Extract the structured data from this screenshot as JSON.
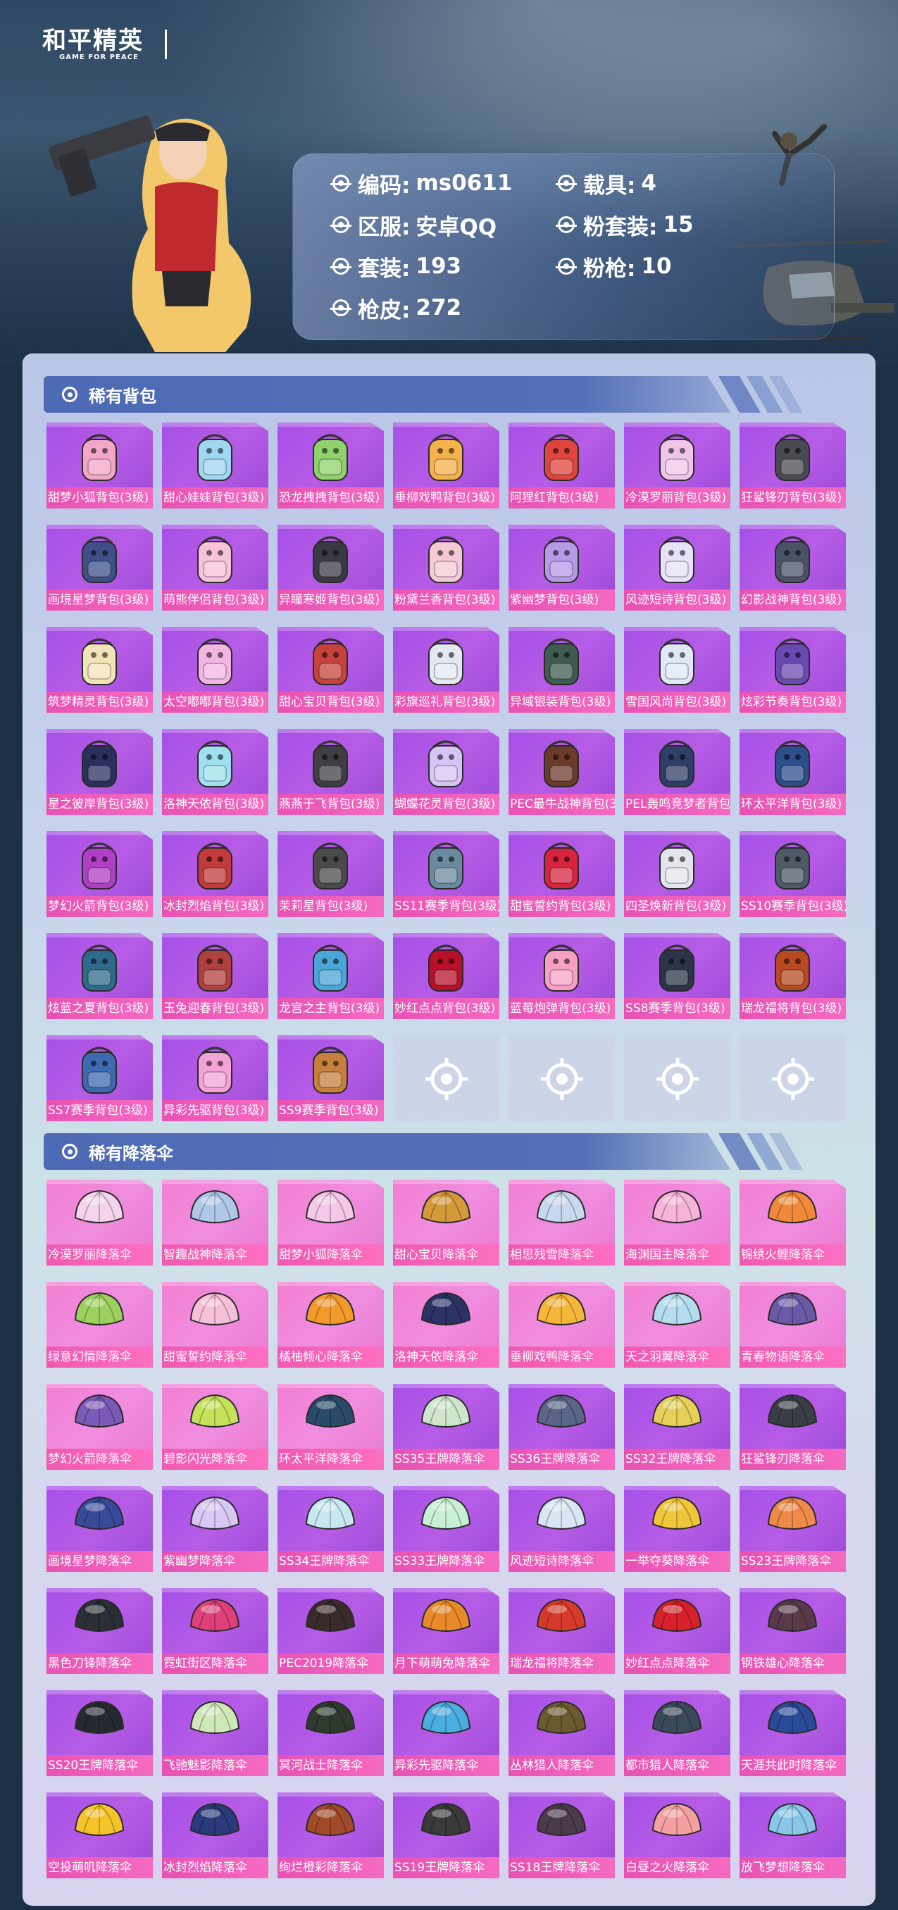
{
  "header": {
    "logo_main": "和平精英",
    "logo_sub": "GAME FOR PEACE"
  },
  "info": {
    "code_label": "编码:",
    "code_value": "ms0611",
    "vehicle_label": "载具:",
    "vehicle_value": "4",
    "server_label": "区服:",
    "server_value": "安卓QQ",
    "pink_suit_label": "粉套装:",
    "pink_suit_value": "15",
    "suit_label": "套装:",
    "suit_value": "193",
    "pink_gun_label": "粉枪:",
    "pink_gun_value": "10",
    "gun_skin_label": "枪皮:",
    "gun_skin_value": "272"
  },
  "sections": {
    "backpacks_title": "稀有背包",
    "parachutes_title": "稀有降落伞"
  },
  "backpacks": [
    "甜梦小狐背包(3级)",
    "甜心娃娃背包(3级)",
    "恐龙拽拽背包(3级)",
    "垂柳戏鸭背包(3级)",
    "阿狸红背包(3级)",
    "冷漠罗丽背包(3级)",
    "狂鲨锋刃背包(3级)",
    "画境星梦背包(3级)",
    "萌熊伴侣背包(3级)",
    "异瞳寒姬背包(3级)",
    "粉黛兰香背包(3级)",
    "紫幽梦背包(3级)",
    "风迹短诗背包(3级)",
    "幻影战神背包(3级)",
    "筑梦精灵背包(3级)",
    "太空嘟嘟背包(3级)",
    "甜心宝贝背包(3级)",
    "彩旗巡礼背包(3级)",
    "异域银装背包(3级)",
    "雪国风尚背包(3级)",
    "炫彩节奏背包(3级)",
    "星之彼岸背包(3级)",
    "洛神天依背包(3级)",
    "燕燕于飞背包(3级)",
    "蝴蝶花灵背包(3级)",
    "PEC最牛战神背包(3",
    "PEL轰鸣竞梦者背包",
    "环太平洋背包(3级)",
    "梦幻火箭背包(3级)",
    "冰封烈焰背包(3级)",
    "茉莉星背包(3级)",
    "SS11赛季背包(3级)",
    "甜蜜誓约背包(3级)",
    "四圣焕新背包(3级)",
    "SS10赛季背包(3级)",
    "炫蓝之夏背包(3级)",
    "玉兔迎春背包(3级)",
    "龙宫之主背包(3级)",
    "妙红点点背包(3级)",
    "蓝莓炮弹背包(3级)",
    "SS8赛季背包(3级)",
    "瑞龙福将背包(3级)",
    "SS7赛季背包(3级)",
    "异彩先驱背包(3级)",
    "SS9赛季背包(3级)"
  ],
  "backpack_colors": [
    "#f3a6c8",
    "#9fd6f0",
    "#8fd16a",
    "#f6b24a",
    "#e0453d",
    "#f0c6e8",
    "#4a4a52",
    "#3f4f8a",
    "#f7c3d8",
    "#3a3a44",
    "#f4cbd4",
    "#b69ae8",
    "#e7e2f6",
    "#4a5266",
    "#f2e4b8",
    "#f3b6e3",
    "#c6433d",
    "#e4e8f0",
    "#3f5a4e",
    "#dfe8f4",
    "#6a4ab2",
    "#2b2f5e",
    "#9ee0ee",
    "#3e3e44",
    "#d6c4f4",
    "#6b3a2a",
    "#2e3e66",
    "#2c4e8a",
    "#b03ec6",
    "#c23a3a",
    "#4a4a4a",
    "#6b8aa0",
    "#d8233d",
    "#e4e4ec",
    "#4e5a66",
    "#2e6b8a",
    "#b04040",
    "#4aa6d6",
    "#b8102a",
    "#f7a0c4",
    "#2e3448",
    "#b84a22",
    "#3e6ab2",
    "#f3a4d6",
    "#c6803e"
  ],
  "parachutes": [
    "冷漠罗丽降落伞",
    "智趣战神降落伞",
    "甜梦小狐降落伞",
    "甜心宝贝降落伞",
    "相思残雪降落伞",
    "海渊国主降落伞",
    "锦绣火鲤降落伞",
    "绿意幻情降落伞",
    "甜蜜誓约降落伞",
    "橘柚倾心降落伞",
    "洛神天依降落伞",
    "垂柳戏鸭降落伞",
    "天之羽翼降落伞",
    "青春物语降落伞",
    "梦幻火箭降落伞",
    "碧影闪光降落伞",
    "环太平洋降落伞",
    "SS35王牌降落伞",
    "SS36王牌降落伞",
    "SS32王牌降落伞",
    "狂鲨锋刃降落伞",
    "画境星梦降落伞",
    "紫幽梦降落伞",
    "SS34王牌降落伞",
    "SS33王牌降落伞",
    "风迹短诗降落伞",
    "一举夺葵降落伞",
    "SS23王牌降落伞",
    "黑色刀锋降落伞",
    "霓虹街区降落伞",
    "PEC2019降落伞",
    "月下萌萌兔降落伞",
    "瑞龙福将降落伞",
    "妙红点点降落伞",
    "钢铁雄心降落伞",
    "SS20王牌降落伞",
    "飞驰魅影降落伞",
    "冥河战士降落伞",
    "异彩先驱降落伞",
    "丛林猎人降落伞",
    "都市猎人降落伞",
    "天涯共此时降落伞",
    "空投萌叽降落伞",
    "冰封烈焰降落伞",
    "绚烂橙彩降落伞",
    "SS19王牌降落伞",
    "SS18王牌降落伞",
    "白昼之火降落伞",
    "放飞梦想降落伞"
  ],
  "parachute_colors": [
    "#f4d4ec",
    "#b0c8e8",
    "#f4c8e8",
    "#d49a3a",
    "#c8d8ee",
    "#f6b4d8",
    "#f08a3a",
    "#9ed060",
    "#f6c0d8",
    "#f39a2a",
    "#2a3266",
    "#f6b63a",
    "#b6dcf0",
    "#6a5aa6",
    "#7a5ab6",
    "#c6e25a",
    "#2a4a6a",
    "#cfe6cc",
    "#5a6688",
    "#e6d05a",
    "#3a3e44",
    "#3a4a9a",
    "#d8c8f4",
    "#c8e8f0",
    "#c8f0d4",
    "#d8e6f4",
    "#f0c63a",
    "#f08a4a",
    "#2a2e36",
    "#e0407a",
    "#3a2a2a",
    "#e88a2a",
    "#d83a2a",
    "#d8202a",
    "#5a3a4a",
    "#262a30",
    "#cfe8b8",
    "#2e3a2e",
    "#4aaee0",
    "#6a5a2e",
    "#3a4a5a",
    "#2a4a9a",
    "#f4c42a",
    "#2a3a7a",
    "#a04a2a",
    "#3a3a3a",
    "#4a3a4a",
    "#f4a0a0",
    "#8ac6e8"
  ],
  "parachute_card_style": [
    "pink",
    "pink",
    "pink",
    "pink",
    "pink",
    "pink",
    "pink",
    "pink",
    "pink",
    "pink",
    "pink",
    "pink",
    "pink",
    "pink",
    "pink",
    "pink",
    "pink",
    "purple",
    "purple",
    "purple",
    "purple",
    "purple",
    "purple",
    "purple",
    "purple",
    "purple",
    "purple",
    "purple",
    "purple",
    "purple",
    "purple",
    "purple",
    "purple",
    "purple",
    "purple",
    "purple",
    "purple",
    "purple",
    "purple",
    "purple",
    "purple",
    "purple",
    "purple",
    "purple",
    "purple",
    "purple",
    "purple",
    "purple",
    "purple"
  ],
  "empty_slot_count": 4
}
